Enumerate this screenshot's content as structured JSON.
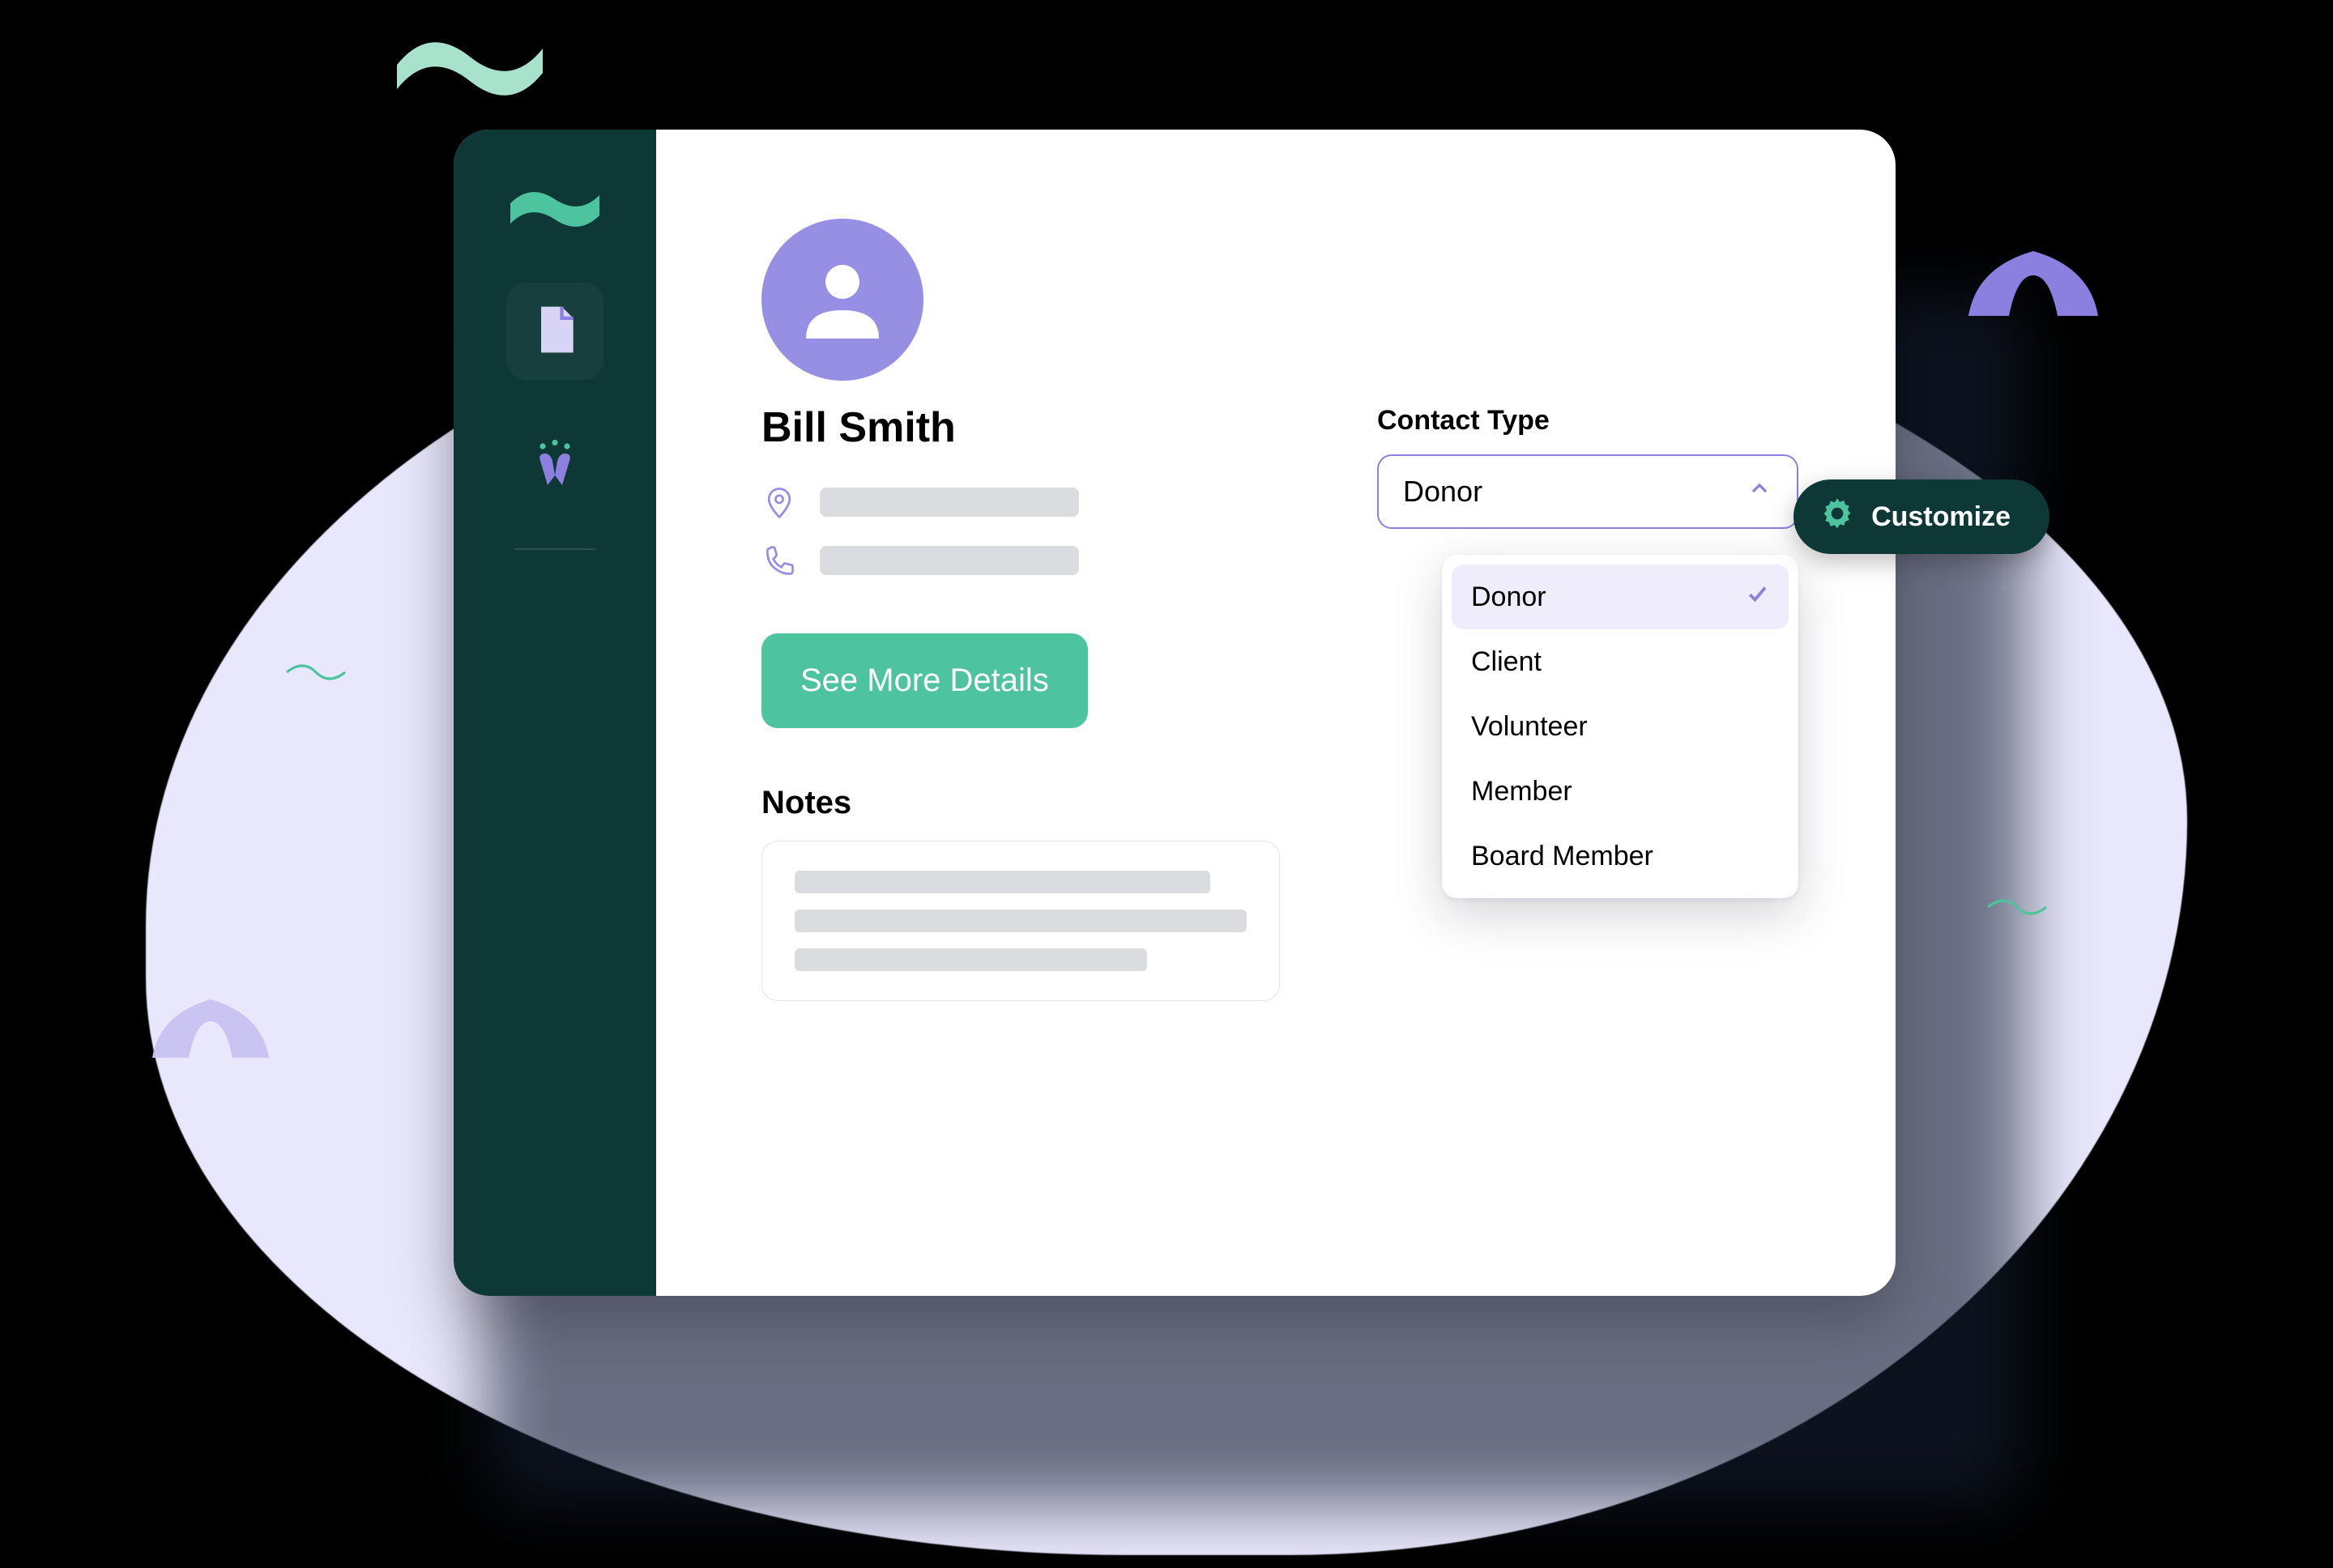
{
  "contact": {
    "name": "Bill Smith"
  },
  "buttons": {
    "see_more": "See More Details",
    "customize": "Customize"
  },
  "sections": {
    "notes": "Notes"
  },
  "contact_type": {
    "label": "Contact Type",
    "selected": "Donor",
    "options": [
      "Donor",
      "Client",
      "Volunteer",
      "Member",
      "Board Member"
    ]
  },
  "colors": {
    "sidebar": "#0E3836",
    "accent_green": "#4DC39E",
    "accent_purple": "#978FE4",
    "blob": "#E9E7FB"
  }
}
